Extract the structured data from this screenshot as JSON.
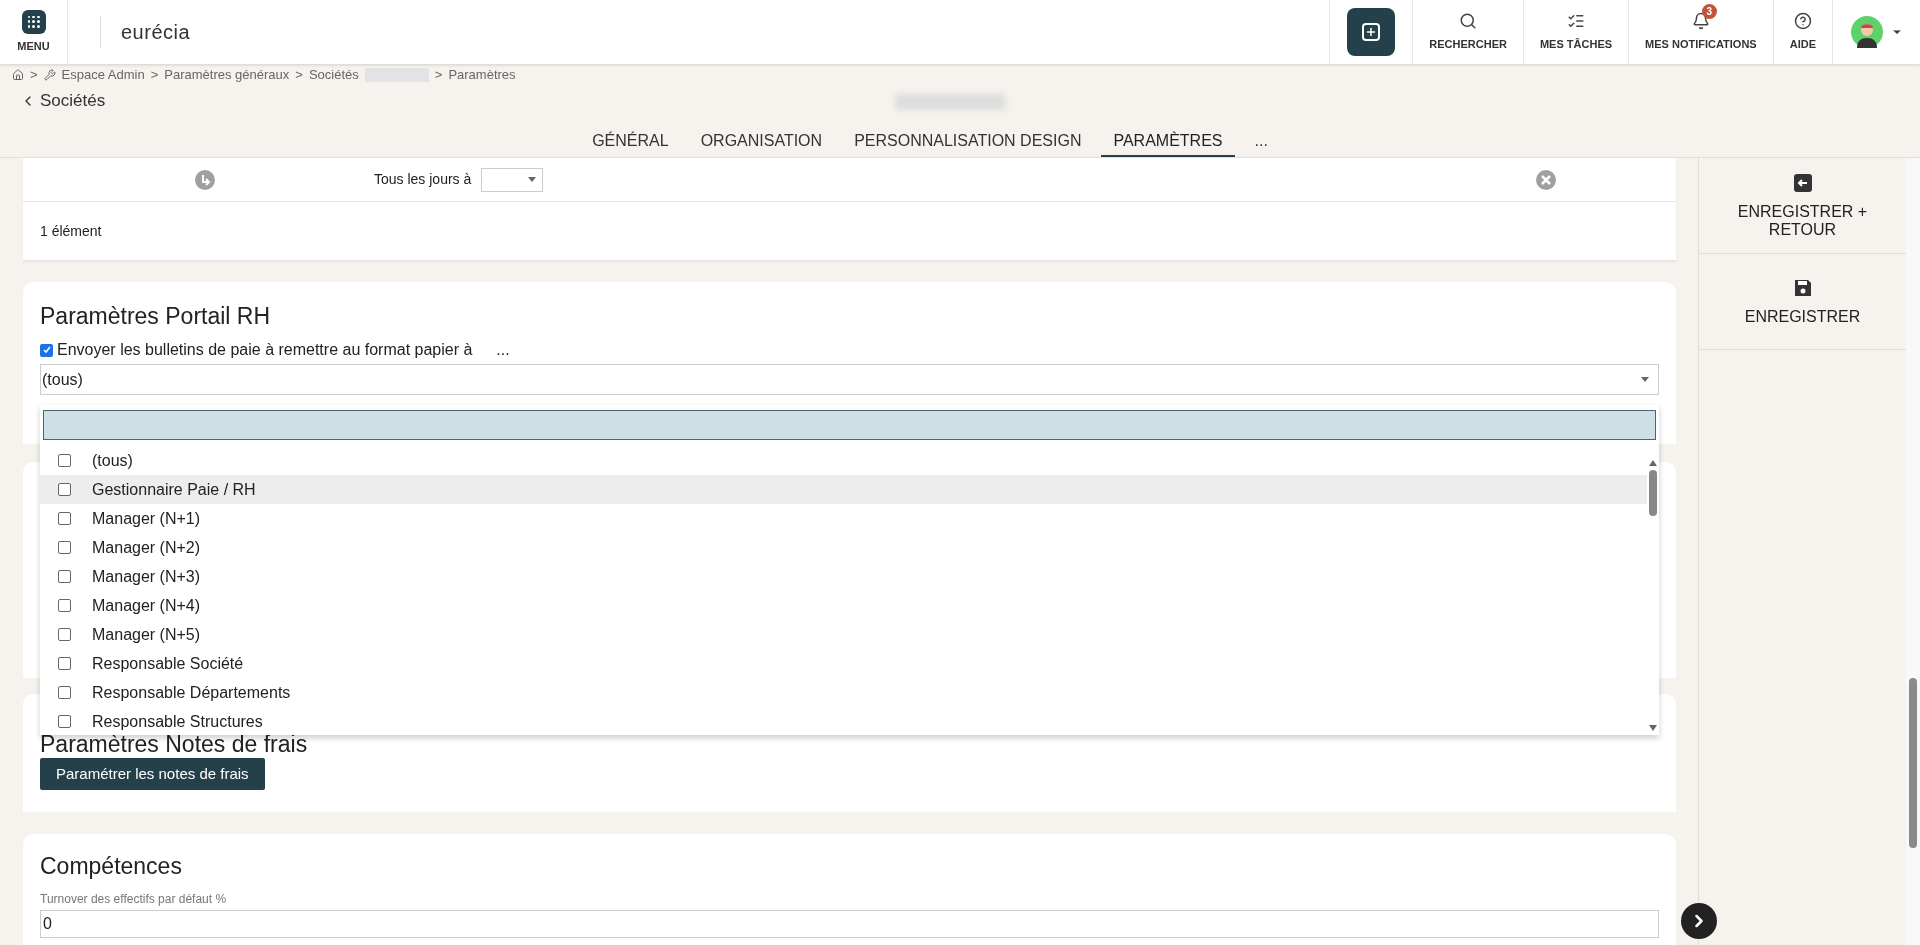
{
  "header": {
    "menu_label": "MENU",
    "logo": "eurécia",
    "actions": [
      {
        "kind": "search",
        "label": "RECHERCHER"
      },
      {
        "kind": "tasks",
        "label": "MES TÂCHES"
      },
      {
        "kind": "bell",
        "label": "MES NOTIFICATIONS",
        "badge": "3"
      },
      {
        "kind": "help",
        "label": "AIDE"
      }
    ]
  },
  "breadcrumb": {
    "separator": ">",
    "items": [
      "Espace Admin",
      "Paramètres généraux",
      "Sociétés"
    ],
    "last": "Paramètres"
  },
  "back_link": "Sociétés",
  "tabs": [
    {
      "label": "GÉNÉRAL",
      "selected": false
    },
    {
      "label": "ORGANISATION",
      "selected": false
    },
    {
      "label": "PERSONNALISATION DESIGN",
      "selected": false
    },
    {
      "label": "PARAMÈTRES",
      "selected": true
    },
    {
      "label": "...",
      "selected": false
    }
  ],
  "schedule": {
    "label": "Tous les jours à",
    "count": "1 élément"
  },
  "portail": {
    "title": "Paramètres Portail RH",
    "checkbox_label": "Envoyer les bulletins de paie à remettre au format papier à",
    "checked": true,
    "more": "...",
    "select_value": "(tous)",
    "options": [
      {
        "label": "(tous)",
        "checked": false,
        "selected": false
      },
      {
        "label": "Gestionnaire Paie / RH",
        "checked": false,
        "selected": true
      },
      {
        "label": "Manager (N+1)",
        "checked": false,
        "selected": false
      },
      {
        "label": "Manager (N+2)",
        "checked": false,
        "selected": false
      },
      {
        "label": "Manager (N+3)",
        "checked": false,
        "selected": false
      },
      {
        "label": "Manager (N+4)",
        "checked": false,
        "selected": false
      },
      {
        "label": "Manager (N+5)",
        "checked": false,
        "selected": false
      },
      {
        "label": "Responsable Société",
        "checked": false,
        "selected": false
      },
      {
        "label": "Responsable Départements",
        "checked": false,
        "selected": false
      },
      {
        "label": "Responsable Structures",
        "checked": false,
        "selected": false
      }
    ]
  },
  "notes": {
    "title": "Paramètres Notes de frais",
    "button": "Paramétrer les notes de frais"
  },
  "competences": {
    "title": "Compétences",
    "field_label": "Turnover des effectifs par défaut %",
    "field_value": "0"
  },
  "side_actions": [
    {
      "kind": "save-return",
      "label": "ENREGISTRER + RETOUR"
    },
    {
      "kind": "save",
      "label": "ENREGISTRER"
    }
  ]
}
